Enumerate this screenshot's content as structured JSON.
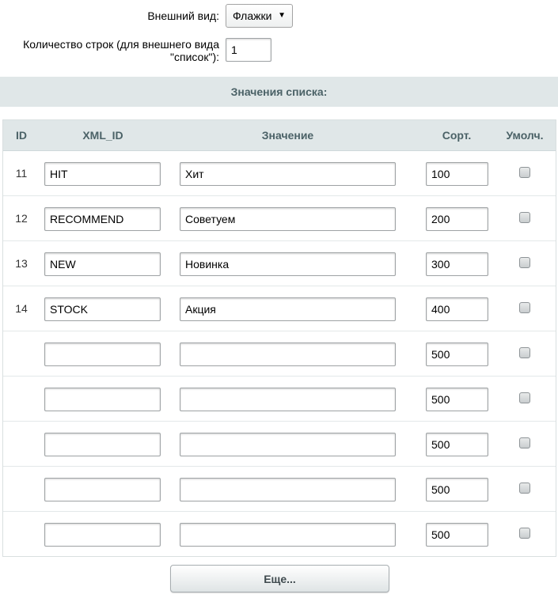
{
  "settings": {
    "view_label": "Внешний вид:",
    "view_value": "Флажки",
    "rows_label_line1": "Количество строк (для внешнего вида",
    "rows_label_line2": "\"список\"):",
    "rows_value": "1"
  },
  "section_title": "Значения списка:",
  "table": {
    "headers": {
      "id": "ID",
      "xml_id": "XML_ID",
      "value": "Значение",
      "sort": "Сорт.",
      "default": "Умолч."
    },
    "rows": [
      {
        "id": "11",
        "xml_id": "HIT",
        "value": "Хит",
        "sort": "100",
        "default": false
      },
      {
        "id": "12",
        "xml_id": "RECOMMEND",
        "value": "Советуем",
        "sort": "200",
        "default": false
      },
      {
        "id": "13",
        "xml_id": "NEW",
        "value": "Новинка",
        "sort": "300",
        "default": false
      },
      {
        "id": "14",
        "xml_id": "STOCK",
        "value": "Акция",
        "sort": "400",
        "default": false
      },
      {
        "id": "",
        "xml_id": "",
        "value": "",
        "sort": "500",
        "default": false
      },
      {
        "id": "",
        "xml_id": "",
        "value": "",
        "sort": "500",
        "default": false
      },
      {
        "id": "",
        "xml_id": "",
        "value": "",
        "sort": "500",
        "default": false
      },
      {
        "id": "",
        "xml_id": "",
        "value": "",
        "sort": "500",
        "default": false
      },
      {
        "id": "",
        "xml_id": "",
        "value": "",
        "sort": "500",
        "default": false
      }
    ]
  },
  "more_button_label": "Еще..."
}
